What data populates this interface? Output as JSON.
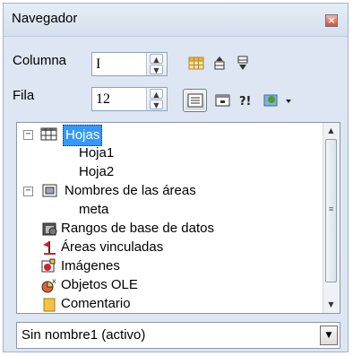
{
  "window": {
    "title": "Navegador"
  },
  "fields": {
    "column_label": "Columna",
    "column_value": "I",
    "row_label": "Fila",
    "row_value": "12"
  },
  "tree": {
    "items": [
      {
        "label": "Hojas",
        "icon": "sheets-icon",
        "expanded": true,
        "selected": true
      },
      {
        "label": "Hoja1"
      },
      {
        "label": "Hoja2"
      },
      {
        "label": "Nombres de las áreas",
        "icon": "range-names-icon",
        "expanded": true
      },
      {
        "label": "meta"
      },
      {
        "label": "Rangos de base de datos",
        "icon": "database-range-icon"
      },
      {
        "label": "Áreas vinculadas",
        "icon": "linked-area-icon"
      },
      {
        "label": "Imágenes",
        "icon": "images-icon"
      },
      {
        "label": "Objetos OLE",
        "icon": "ole-objects-icon"
      },
      {
        "label": "Comentario",
        "icon": "comment-icon"
      }
    ],
    "expander_collapse": "−"
  },
  "document_select": {
    "value": "Sin nombre1 (activo)"
  },
  "colors": {
    "selection": "#3399ff",
    "panel": "#dde6f2",
    "border": "#8d99a8"
  }
}
